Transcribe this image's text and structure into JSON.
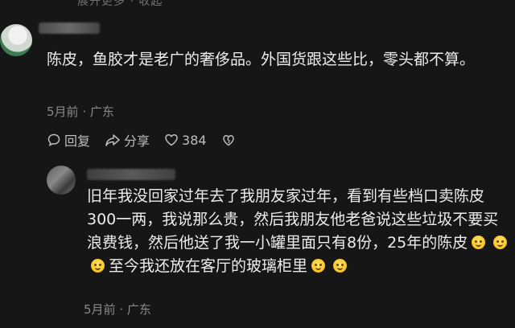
{
  "header": {
    "collapsed_hint": "展开更多 · 收起"
  },
  "comments": [
    {
      "text": "陈皮，鱼胶才是老广的奢侈品。外国货跟这些比，零头都不算。",
      "time": "5月前",
      "location": "广东",
      "actions": {
        "reply": "回复",
        "share": "分享",
        "likes": "384"
      }
    },
    {
      "text_1": "旧年我没回家过年去了我朋友家过年，看到有些档口卖陈皮300一两，我说那么贵，然后我朋友他老爸说这些垃圾不要买浪费钱，然后他送了我一小罐里面只有8份，25年的陈皮",
      "text_2": "至今我还放在客厅的玻璃柜里",
      "time": "5月前",
      "location": "广东"
    }
  ],
  "icons": {
    "reply": "comment-bubble-icon",
    "share": "share-arrow-icon",
    "like": "heart-icon",
    "dislike": "broken-heart-icon",
    "emoji": "smiling-face-emoji"
  }
}
